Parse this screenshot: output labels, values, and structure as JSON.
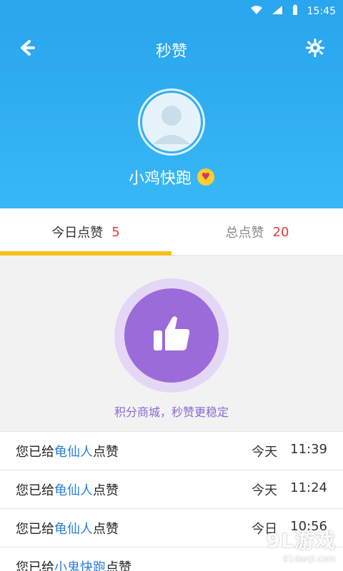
{
  "status": {
    "time": "15:45",
    "icons": [
      "wifi-icon",
      "signal-icon",
      "battery-icon"
    ]
  },
  "header": {
    "title": "秒赞",
    "username": "小鸡快跑",
    "emoji": "heart-eyes-emoji",
    "colors": {
      "bg": "#2aa6ee"
    }
  },
  "tabs": [
    {
      "label": "今日点赞",
      "count": "5",
      "active": true
    },
    {
      "label": "总点赞",
      "count": "20",
      "active": false
    }
  ],
  "like": {
    "caption": "积分商城，秒赞更稳定",
    "colors": {
      "button": "#9b6bd9",
      "halo": "#e4d7f5"
    }
  },
  "list": [
    {
      "prefix": "您已给",
      "name": "龟仙人",
      "suffix": "点赞",
      "day": "今天",
      "time": "11:39"
    },
    {
      "prefix": "您已给",
      "name": "龟仙人",
      "suffix": "点赞",
      "day": "今天",
      "time": "11:24"
    },
    {
      "prefix": "您已给",
      "name": "龟仙人",
      "suffix": "点赞",
      "day": "今日",
      "time": "10:56"
    },
    {
      "prefix": "您已给",
      "name": "小鬼快跑",
      "suffix": "点赞",
      "day": "",
      "time": ""
    }
  ],
  "watermark": {
    "main": "9L游戏",
    "sub": "91danji.com"
  }
}
